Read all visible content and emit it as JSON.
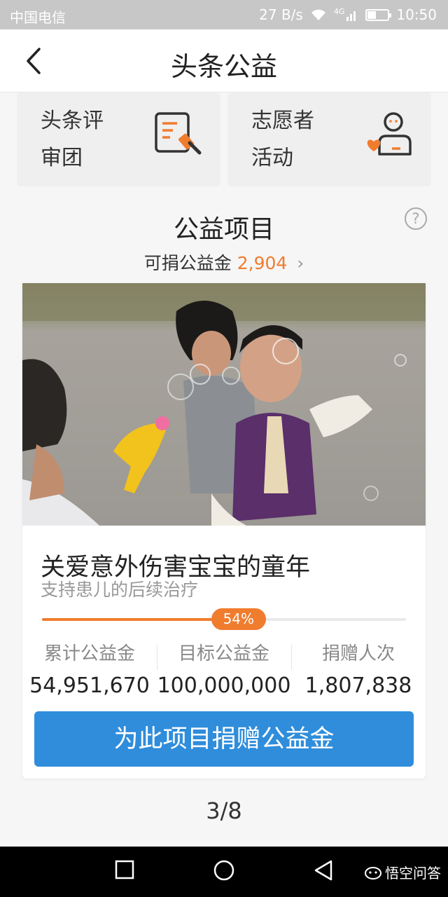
{
  "status_bar": {
    "carrier": "中国电信",
    "speed": "27 B/s",
    "network": "4G",
    "time": "10:50"
  },
  "header": {
    "title": "头条公益"
  },
  "cards": [
    {
      "label": "头条评\n审团",
      "icon": "review-icon"
    },
    {
      "label": "志愿者\n活动",
      "icon": "volunteer-icon"
    }
  ],
  "section": {
    "title": "公益项目",
    "balance_label": "可捐公益金",
    "balance_value": "2,904"
  },
  "project": {
    "title": "关爱意外伤害宝宝的童年",
    "subtitle": "支持患儿的后续治疗",
    "progress": 0.54,
    "progress_text": "54%",
    "stats": [
      {
        "label": "累计公益金",
        "value": "54,951,670"
      },
      {
        "label": "目标公益金",
        "value": "100,000,000"
      },
      {
        "label": "捐赠人次",
        "value": "1,807,838"
      }
    ],
    "donate_label": "为此项目捐赠公益金"
  },
  "pager": "3/8",
  "watermark": "悟空问答",
  "colors": {
    "accent": "#f07c2e",
    "button": "#2f8ddb",
    "status_bar": "#c7c7c7"
  }
}
